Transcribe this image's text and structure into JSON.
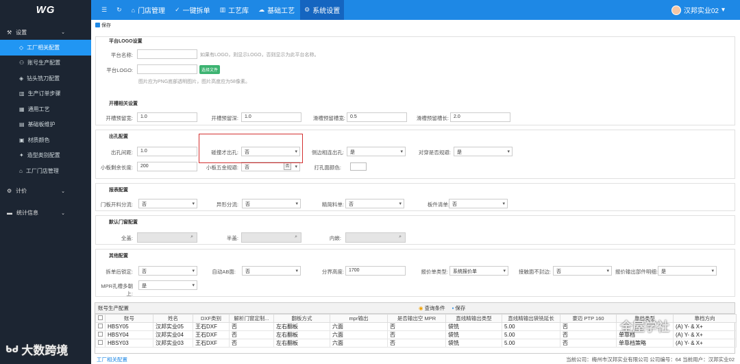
{
  "brand": {
    "logo_text": "WG"
  },
  "topnav": {
    "items": [
      {
        "label": "",
        "icon": "menu-icon"
      },
      {
        "label": "",
        "icon": "refresh-icon"
      },
      {
        "label": "门店管理",
        "icon": "home-icon"
      },
      {
        "label": "一键拆单",
        "icon": "check-circle-icon"
      },
      {
        "label": "工艺库",
        "icon": "book-icon"
      },
      {
        "label": "基础工艺",
        "icon": "cloud-icon"
      },
      {
        "label": "系统设置",
        "icon": "gear-icon"
      }
    ],
    "user": "汉邦实业02"
  },
  "sidebar": {
    "group_settings": "设置",
    "items": [
      {
        "label": "工厂相关配置",
        "icon": "tag-icon"
      },
      {
        "label": "账号生产配置",
        "icon": "user-icon"
      },
      {
        "label": "钻头铣刀配置",
        "icon": "diamond-icon"
      },
      {
        "label": "生产订单步骤",
        "icon": "columns-icon"
      },
      {
        "label": "通用工艺",
        "icon": "calendar-icon"
      },
      {
        "label": "基础板维护",
        "icon": "layers-icon"
      },
      {
        "label": "材质颜色",
        "icon": "id-card-icon"
      },
      {
        "label": "造型类别配置",
        "icon": "puzzle-icon"
      },
      {
        "label": "工厂门店管理",
        "icon": "home-icon"
      }
    ],
    "group_pricing": "计价",
    "group_stats": "统计信息"
  },
  "toolbar": {
    "save": "保存"
  },
  "logo_section": {
    "legend": "平台LOGO设置",
    "name_label": "平台名称:",
    "name_hint": "如果有LOGO，则显示LOGO，否则显示为此平台名称。",
    "logo_label": "平台LOGO:",
    "file_button": "选择文件",
    "logo_hint": "图片应为PNG底部透明图片，图片高度应为58像素。"
  },
  "slot_section": {
    "legend": "开槽相关设置",
    "f1_label": "开槽预留宽:",
    "f1_value": "1.0",
    "f2_label": "开槽预留深:",
    "f2_value": "1.0",
    "f3_label": "滑槽预留槽宽:",
    "f3_value": "0.5",
    "f4_label": "滑槽预留槽长:",
    "f4_value": "2.0"
  },
  "hole_section": {
    "legend": "出孔配置",
    "f1_label": "出孔间距:",
    "f1_value": "1.0",
    "f2_label": "碰撞才出孔:",
    "f2_value": "否",
    "f3_label": "侧边相连出孔:",
    "f3_value": "是",
    "f4_label": "对穿是否规避:",
    "f4_value": "是",
    "f5_label": "小板剩余长度:",
    "f5_value": "200",
    "f6_label": "小板五金规避:",
    "f6_value": "否",
    "f6_stepper": "否",
    "f7_label": "打孔面颜色:"
  },
  "report_section": {
    "legend": "报表配置",
    "f1_label": "门板开料分流:",
    "f1_value": "否",
    "f2_label": "异形分流:",
    "f2_value": "否",
    "f3_label": "精简料单:",
    "f3_value": "否",
    "f4_label": "板件清单:",
    "f4_value": "否"
  },
  "door_section": {
    "legend": "默认门窗配置",
    "f1_label": "全盖:",
    "f2_label": "半盖:",
    "f3_label": "内嵌:"
  },
  "other_section": {
    "legend": "其他配置",
    "f1_label": "拆单后锁定:",
    "f1_value": "否",
    "f2_label": "自动AB面:",
    "f2_value": "否",
    "f3_label": "分界高度:",
    "f3_value": "1700",
    "f4_label": "报价单类型:",
    "f4_value": "系统报价单",
    "f5_label": "接触面不封边:",
    "f5_value": "否",
    "f6_label": "报价输出部件明细:",
    "f6_value": "是",
    "f7_label": "MPR孔槽多朝上:",
    "f7_value": "是"
  },
  "grid": {
    "title": "账号生产配置",
    "query": "查询条件",
    "save": "保存",
    "columns": [
      "",
      "账号",
      "姓名",
      "DXF类别",
      "解析门窗定制...",
      "翻板方式",
      "mpr输出",
      "是否输出空 MPR",
      "直线精输出类型",
      "直线精输出袋铣延长",
      "豪迈 PTP 160",
      "靠档类型",
      "靠档方向"
    ],
    "rows": [
      [
        "",
        "HBSY05",
        "汉邦实业05",
        "王石DXF",
        "否",
        "左右翻板",
        "六面",
        "否",
        "袋铣",
        "5.00",
        "否",
        "",
        "(A) Y- & X+"
      ],
      [
        "",
        "HBSY04",
        "汉邦实业04",
        "王石DXF",
        "否",
        "左右翻板",
        "六面",
        "否",
        "袋铣",
        "5.00",
        "否",
        "单靠档",
        "(A) Y- & X+"
      ],
      [
        "",
        "HBSY03",
        "汉邦实业03",
        "王石DXF",
        "否",
        "左右翻板",
        "六面",
        "否",
        "袋铣",
        "5.00",
        "否",
        "单靠档策略",
        "(A) Y- & X+"
      ]
    ]
  },
  "status": {
    "left": "工厂相关配置",
    "right": "当前公司：梅州市汉邦实业有限公司   公司编号：64   当前用户：汉邦实业02"
  },
  "watermark": {
    "left": "大数跨境",
    "right": "全屋学社"
  }
}
